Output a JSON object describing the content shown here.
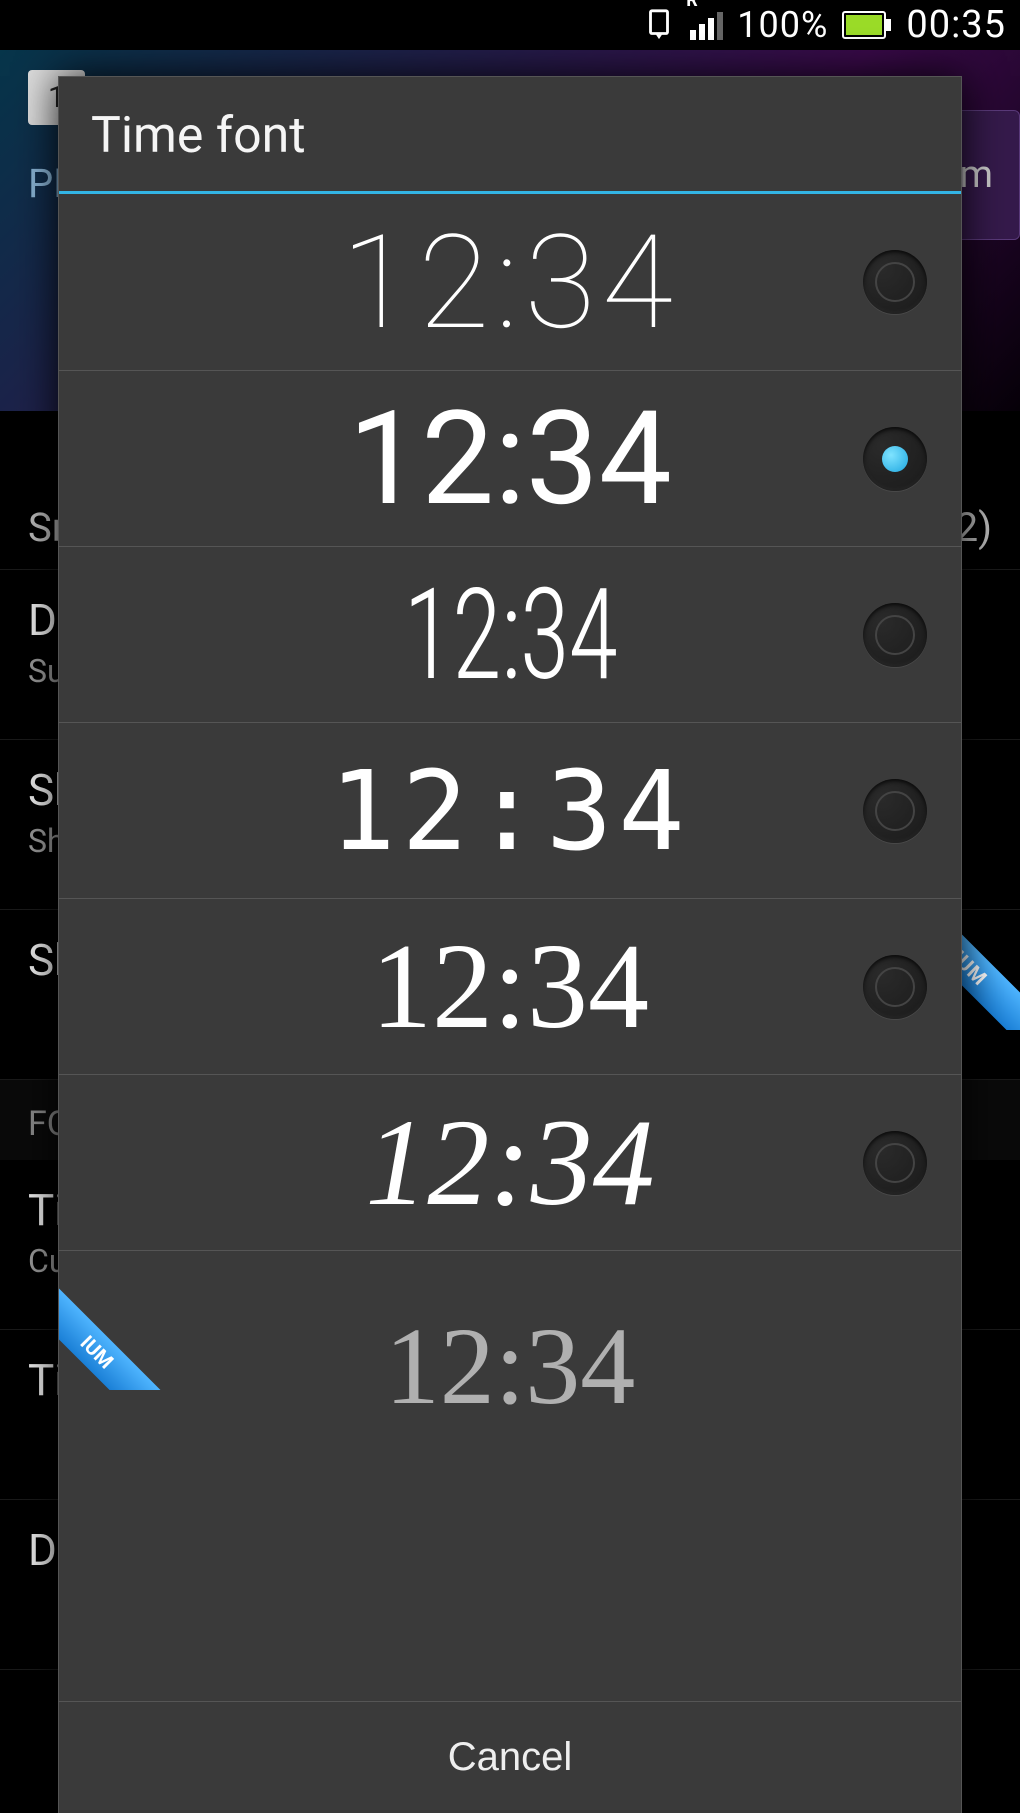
{
  "status": {
    "battery_pct": "100%",
    "clock": "00:35",
    "signal_label": "R"
  },
  "background": {
    "tab_label_left": "PR",
    "premium_btn": "m",
    "snap_label": "Sn",
    "snap_right": "2)",
    "rows": [
      {
        "title": "Da",
        "sub": "Su"
      },
      {
        "title": "Sh",
        "sub": "Sh"
      },
      {
        "title": "Sh",
        "sub": ""
      }
    ],
    "section_header": "FO",
    "rows2": [
      {
        "title": "Ti",
        "sub": "Cu"
      },
      {
        "title": "Ti",
        "sub": ""
      },
      {
        "title": "Da",
        "sub": ""
      }
    ],
    "premium_ribbon": "IUM"
  },
  "dialog": {
    "title": "Time font",
    "sample_text": "12:34",
    "options": [
      {
        "id": "thin",
        "selected": false,
        "premium": false
      },
      {
        "id": "regular",
        "selected": true,
        "premium": false
      },
      {
        "id": "condensed",
        "selected": false,
        "premium": false
      },
      {
        "id": "lcd",
        "selected": false,
        "premium": false
      },
      {
        "id": "slab",
        "selected": false,
        "premium": false
      },
      {
        "id": "serif",
        "selected": false,
        "premium": false
      },
      {
        "id": "script",
        "selected": false,
        "premium": true
      }
    ],
    "premium_ribbon": "IUM",
    "cancel": "Cancel"
  },
  "colors": {
    "accent": "#33b5e5"
  }
}
